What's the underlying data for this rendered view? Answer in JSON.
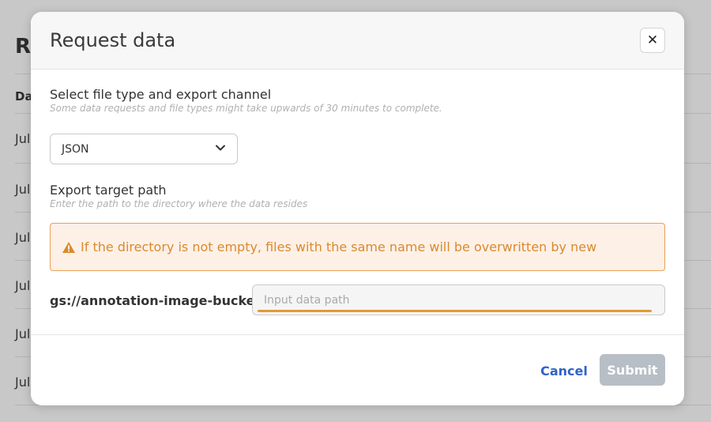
{
  "background": {
    "title": "Re",
    "column_header": "Da",
    "rows": [
      "Jul",
      "Jul",
      "Jul",
      "Jul",
      "Jul",
      "Jul"
    ]
  },
  "modal": {
    "title": "Request data",
    "close_icon": "close-icon",
    "file_type": {
      "label": "Select file type and export channel",
      "hint": "Some data requests and file types might take upwards of 30 minutes to complete.",
      "selected": "JSON"
    },
    "export_path": {
      "label": "Export target path",
      "hint": "Enter the path to the directory where the data resides",
      "warning": "If the directory is not empty, files with the same name will be overwritten by new",
      "prefix": "gs://annotation-image-bucket/",
      "placeholder": "Input data path",
      "value": ""
    },
    "footer": {
      "cancel_label": "Cancel",
      "submit_label": "Submit"
    }
  },
  "colors": {
    "accent": "#2f63c8",
    "warning": "#d98a2e",
    "warning_bg": "#fdf0e6",
    "submit_disabled": "#b7bec6"
  }
}
